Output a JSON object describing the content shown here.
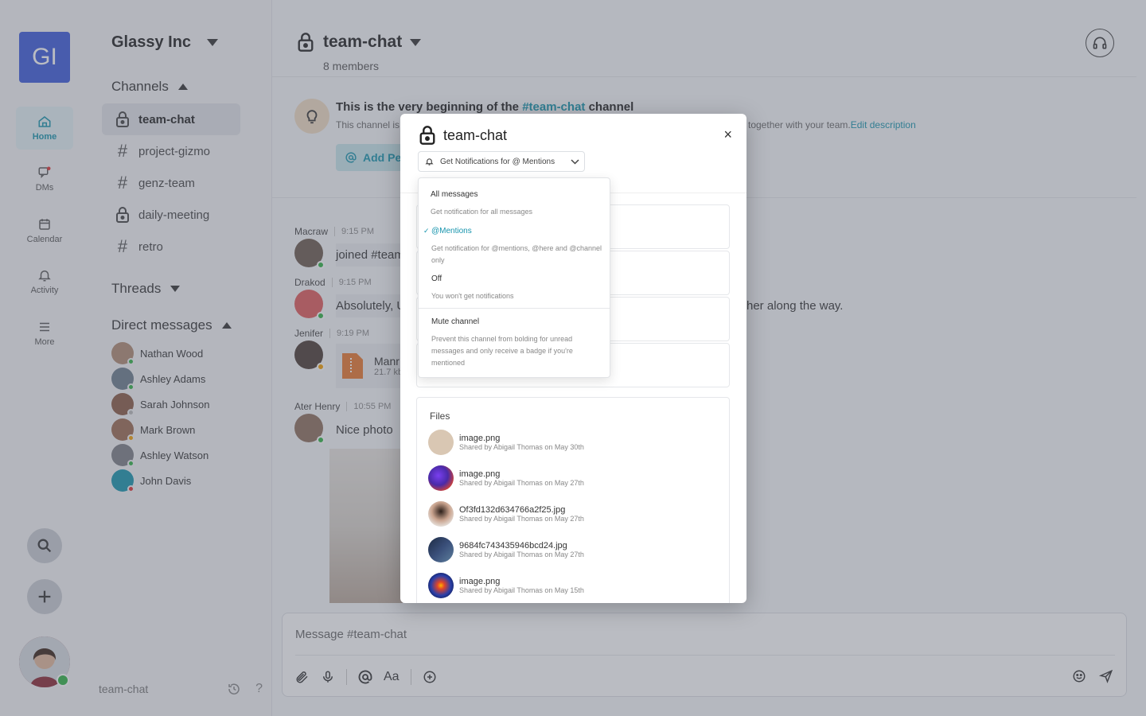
{
  "rail": {
    "org_initials": "GI",
    "items": [
      {
        "label": "Home",
        "icon": "home-icon"
      },
      {
        "label": "DMs",
        "icon": "chat-icon"
      },
      {
        "label": "Calendar",
        "icon": "calendar-icon"
      },
      {
        "label": "Activity",
        "icon": "bell-icon"
      },
      {
        "label": "More",
        "icon": "menu-icon"
      }
    ]
  },
  "sidebar": {
    "workspace": "Glassy Inc",
    "channels_title": "Channels",
    "channels": [
      {
        "name": "team-chat",
        "type": "locked"
      },
      {
        "name": "project-gizmo",
        "type": "hash"
      },
      {
        "name": "genz-team",
        "type": "hash"
      },
      {
        "name": "daily-meeting",
        "type": "locked"
      },
      {
        "name": "retro",
        "type": "hash"
      }
    ],
    "threads_title": "Threads",
    "dm_title": "Direct messages",
    "dms": [
      {
        "name": "Nathan Wood",
        "status": "#2fb344",
        "color": "#b08b72"
      },
      {
        "name": "Ashley Adams",
        "status": "#2fb344",
        "color": "#6b7c8c"
      },
      {
        "name": "Sarah Johnson",
        "status": "#bbbbbb",
        "color": "#8a5a44"
      },
      {
        "name": "Mark Brown",
        "status": "#f59f00",
        "color": "#9c6a50"
      },
      {
        "name": "Ashley Watson",
        "status": "#2fb344",
        "color": "#7d7f85"
      },
      {
        "name": "John Davis",
        "status": "#e03131",
        "color": "#1694ad"
      }
    ],
    "footer": "team-chat"
  },
  "channel": {
    "name": "team-chat",
    "members": "8 members",
    "intro_prefix": "This is the very beginning of the",
    "intro_link": "#team-chat",
    "intro_suffix": "channel",
    "intro_sub_start": "This channel is",
    "intro_sub_end": "together with your team.",
    "edit_description": "Edit description",
    "add_people": "Add Pe"
  },
  "messages": [
    {
      "author": "Macraw",
      "time": "9:15 PM",
      "text": "joined #team"
    },
    {
      "author": "Drakod",
      "time": "9:15 PM",
      "text": "Absolutely, U",
      "text_tail": "her along the way."
    },
    {
      "author": "Jenifer",
      "time": "9:19 PM",
      "file_name": "Manr",
      "file_size": "21.7 kb"
    },
    {
      "author": "Ater Henry",
      "time": "10:55 PM",
      "text": "Nice photo"
    }
  ],
  "composer": {
    "placeholder": "Message #team-chat",
    "format_label": "Aa"
  },
  "modal": {
    "title": "team-chat",
    "notif_button": "Get Notifications for @ Mentions",
    "close": "×",
    "files_title": "Files",
    "files": [
      {
        "name": "image.png",
        "meta": "Shared by Abigail Thomas on May 30th",
        "color": "#d9c7b3"
      },
      {
        "name": "image.png",
        "meta": "Shared by Abigail Thomas on May 27th",
        "color": "#6a3fd1"
      },
      {
        "name": "Of3fd132d634766a2f25.jpg",
        "meta": "Shared by Abigail Thomas on May 27th",
        "color": "#c9a38e"
      },
      {
        "name": "9684fc743435946bcd24.jpg",
        "meta": "Shared by Abigail Thomas on May 27th",
        "color": "#3a4f7a"
      },
      {
        "name": "image.png",
        "meta": "Shared by Abigail Thomas on May 15th",
        "color": "#2a3fa8"
      }
    ]
  },
  "dropdown": {
    "options": [
      {
        "title": "All messages",
        "desc": "Get notification for all messages",
        "selected": false
      },
      {
        "title": "@Mentions",
        "desc": "Get notification for @mentions, @here and @channel only",
        "selected": true
      },
      {
        "title": "Off",
        "desc": "You won't get notifications",
        "selected": false
      },
      {
        "title": "Mute channel",
        "desc": "Prevent this channel from bolding for unread messages and only receive a badge if you're mentioned",
        "selected": false
      }
    ],
    "check": "✓"
  },
  "colors": {
    "accent": "#1694ad",
    "org_tile": "#3b5bdb",
    "online": "#2fb344"
  }
}
